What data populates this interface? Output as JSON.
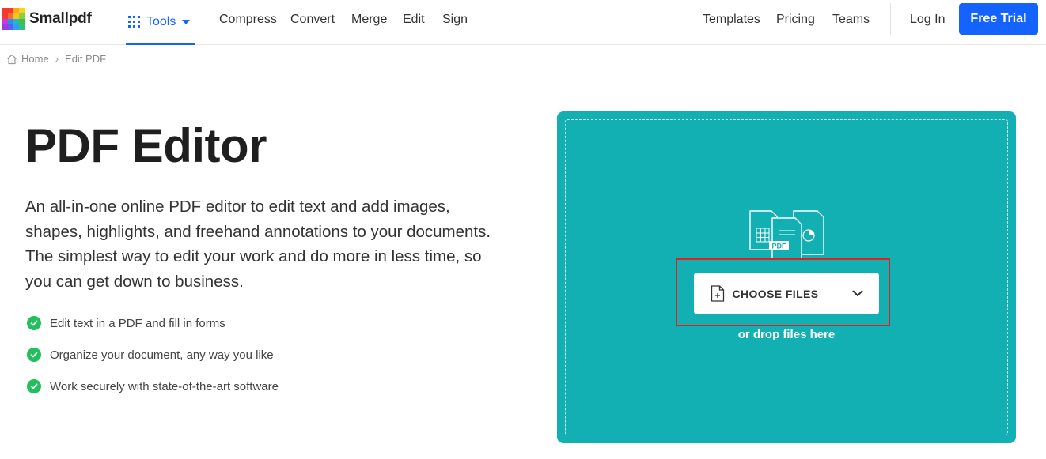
{
  "brand": {
    "name": "Smallpdf",
    "accent": "#1563ff",
    "teal": "#12afb3",
    "check_green": "#20c05c",
    "highlight_red": "#e02020"
  },
  "nav": {
    "tools_label": "Tools",
    "primary_links": [
      "Compress",
      "Convert",
      "Merge",
      "Edit",
      "Sign"
    ],
    "secondary_links": [
      "Templates",
      "Pricing",
      "Teams"
    ],
    "login_label": "Log In",
    "trial_label": "Free Trial"
  },
  "breadcrumb": {
    "home": "Home",
    "current": "Edit PDF",
    "separator": "›"
  },
  "hero": {
    "title": "PDF Editor",
    "description": "An all-in-one online PDF editor to edit text and add images, shapes, highlights, and freehand annotations to your documents. The simplest way to edit your work and do more in less time, so you can get down to business.",
    "features": [
      "Edit text in a PDF and fill in forms",
      "Organize your document, any way you like",
      "Work securely with state-of-the-art software"
    ]
  },
  "upload": {
    "illustration_label": "PDF",
    "choose_label": "CHOOSE FILES",
    "drop_hint": "or drop files here"
  },
  "icons": {
    "logo": "smallpdf-logo-icon",
    "tools": "grid-icon",
    "tools_caret": "caret-down-icon",
    "home": "home-icon",
    "feature": "check-circle-icon",
    "file_add": "file-plus-icon",
    "dropdown": "chevron-down-icon"
  }
}
